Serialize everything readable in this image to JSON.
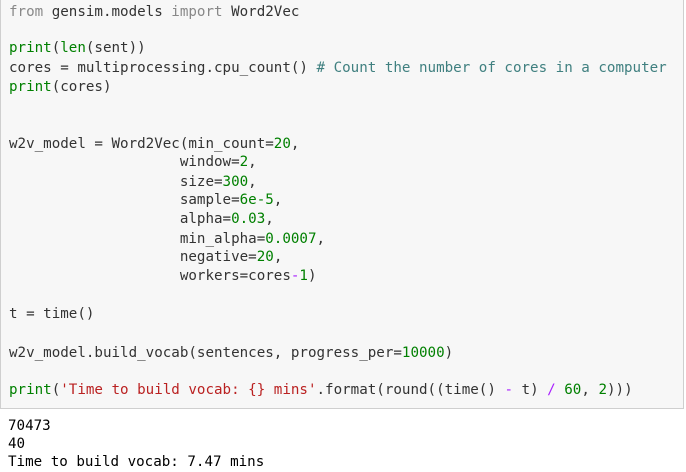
{
  "code_cell": {
    "lines": [
      {
        "a": "from",
        "b": " gensim.models ",
        "c": "import",
        "d": " Word2Vec"
      },
      {
        "a": "print",
        "b": "(",
        "c": "len",
        "d": "(sent))"
      },
      {
        "a": "cores = multiprocessing.cpu_count() ",
        "b": "# Count the number of cores in a computer"
      },
      {
        "a": "print",
        "b": "(cores)"
      },
      {
        "a": "w2v_model = Word2Vec(min_count=",
        "b": "20",
        "c": ","
      },
      {
        "a": "                    window=",
        "b": "2",
        "c": ","
      },
      {
        "a": "                    size=",
        "b": "300",
        "c": ","
      },
      {
        "a": "                    sample=",
        "b": "6e-5",
        "c": ","
      },
      {
        "a": "                    alpha=",
        "b": "0.03",
        "c": ","
      },
      {
        "a": "                    min_alpha=",
        "b": "0.0007",
        "c": ","
      },
      {
        "a": "                    negative=",
        "b": "20",
        "c": ","
      },
      {
        "a": "                    workers=cores",
        "b": "-",
        "c": "1",
        "d": ")"
      },
      {
        "a": "t = time()"
      },
      {
        "a": "w2v_model.build_vocab(sentences, progress_per=",
        "b": "10000",
        "c": ")"
      },
      {
        "a": "print",
        "b": "(",
        "c": "'Time to build vocab: {} mins'",
        "d": ".format(round((time() ",
        "e": "-",
        "f": " t) ",
        "g": "/",
        "h": " ",
        "i": "60",
        "j": ", ",
        "k": "2",
        "l": ")))"
      }
    ]
  },
  "output_cell": {
    "lines": [
      "70473",
      "40",
      "Time to build vocab: 7.47 mins"
    ]
  },
  "colors": {
    "keyword": "#008000",
    "string": "#ba2121",
    "comment": "#408080",
    "operator": "#aa22ff",
    "cell_background": "#f7f7f7"
  }
}
